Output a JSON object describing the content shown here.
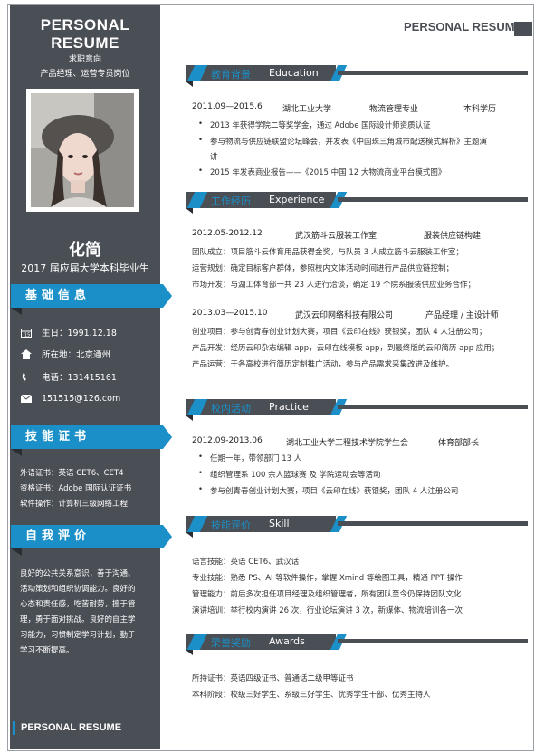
{
  "sidebar": {
    "title": "PERSONAL RESUME",
    "objective_label": "求职意向",
    "objective_roles": "产品经理、运营专员岗位",
    "name": "化简",
    "graduation": "2017 届应届大学本科毕业生",
    "basic_info_header": "基础信息",
    "contacts": [
      {
        "icon": "calendar-icon",
        "text": "生日：1991.12.18"
      },
      {
        "icon": "home-icon",
        "text": "所在地：北京通州"
      },
      {
        "icon": "phone-icon",
        "text": "电话：131415161"
      },
      {
        "icon": "mail-icon",
        "text": "151515@126.com"
      }
    ],
    "skills_header": "技能证书",
    "certs": [
      "外语证书：英语 CET6、CET4",
      "资格证书：Adobe 国际认证证书",
      "软件操作：计算机三级网络工程"
    ],
    "self_eval_header": "自我评价",
    "self_eval": "良好的公共关系意识，善于沟通、活动策划和组织协调能力。良好的心态和责任感，吃苦耐劳，擅于管理，勇于面对挑战。良好的自主学习能力，习惯制定学习计划，勤于学习不断提高。",
    "bottom_mark": "PERSONAL RESUME"
  },
  "header": {
    "title": "PERSONAL RESUME"
  },
  "education": {
    "cn": "教育背景",
    "en": "Education",
    "period": "2011.09—2015.6",
    "school": "湖北工业大学",
    "major": "物流管理专业",
    "degree": "本科学历",
    "items": [
      "2013 年获得学院二等奖学金，通过 Adobe 国际设计师资质认证",
      "参与物流与供应链联盟论坛峰会，并发表《中国珠三角城市配送模式解析》主题演",
      "讲",
      "2015 年发表商业报告——《2015 中国 12 大物流商业平台模式图》"
    ]
  },
  "experience": {
    "cn": "工作经历",
    "en": "Experience",
    "job1": {
      "period": "2012.05-2012.12",
      "company": "武汉筋斗云服装工作室",
      "role": "服装供应链构建",
      "lines": [
        "团队成立：项目筋斗云体育用品获得金奖，与队员 3 人成立筋斗云服装工作室；",
        "运营规划：确定目标客户群体，参照校内文体活动时间进行产品供应链控制；",
        "市场开发：与湖工体育部一共 23 人进行洽谈，确定 19 个院系服装供应业务合作；"
      ]
    },
    "job2": {
      "period": "2013.03—2015.10",
      "company": "武汉云印网络科技有限公司",
      "role": "产品经理 / 主设计师",
      "lines": [
        "创业项目：参与创青春创业计划大赛，项目《云印在线》获银奖，团队 4 人注册公司；",
        "产品开发：经历云印杂志编辑 app，云印在线模板 app，到最终版的云印简历 app 应用；",
        "产品运营：于各高校进行简历定制推广活动，参与产品需求采集改进及维护。"
      ]
    }
  },
  "practice": {
    "cn": "校内活动",
    "en": "Practice",
    "period": "2012.09-2013.06",
    "org": "湖北工业大学工程技术学院学生会",
    "role": "体育部部长",
    "items": [
      "任期一年，带领部门 13 人",
      "组织管理系 100 余人篮球赛 及 学院运动会等活动",
      "参与创青春创业计划大赛，项目《云印在线》获银奖，团队 4 人注册公司"
    ]
  },
  "skill": {
    "cn": "技能评价",
    "en": "Skill",
    "lines": [
      "语言技能：英语 CET6、武汉话",
      "专业技能：熟悉 PS、AI 等软件操作，掌握 Xmind 等绘图工具，精通 PPT 操作",
      "管理能力：前后多次担任项目经理及组织管理者，所有团队至今仍保持团队文化",
      "演讲培训：举行校内演讲 26 次，行业论坛演讲 3 次，新媒体、物流培训各一次"
    ]
  },
  "awards": {
    "cn": "荣誉奖励",
    "en": "Awards",
    "lines": [
      "所持证书：英语四级证书、普通话二级甲等证书",
      "本科阶段：校级三好学生、系级三好学生、优秀学生干部、优秀主持人"
    ]
  }
}
